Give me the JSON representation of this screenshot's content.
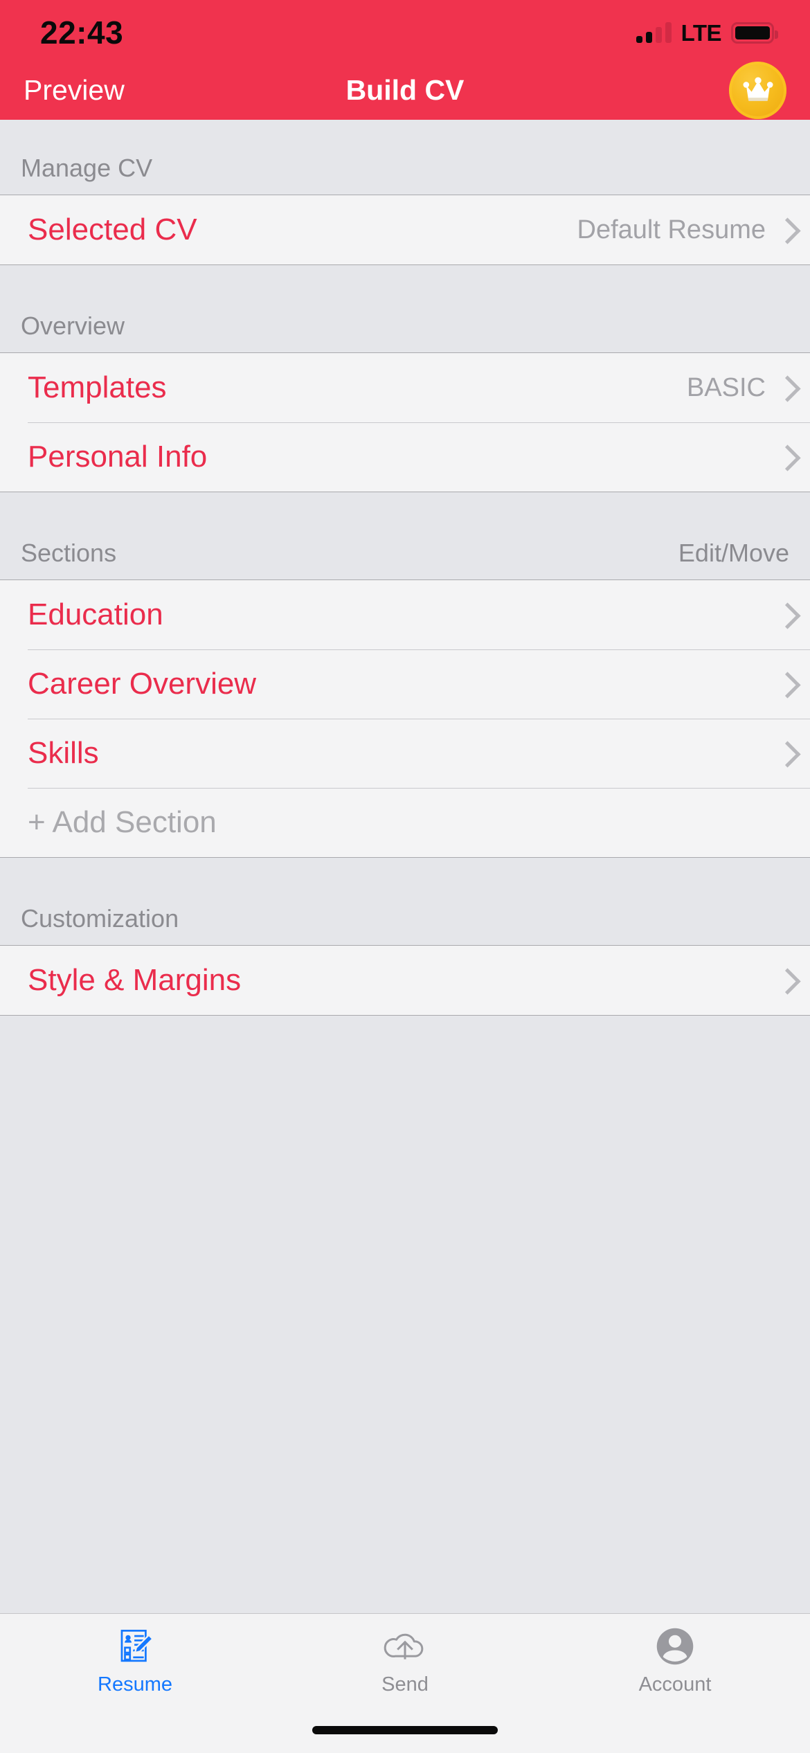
{
  "status_bar": {
    "time": "22:43",
    "network_label": "LTE",
    "signal_icon": "signal-bars-icon",
    "battery_icon": "battery-full-icon"
  },
  "nav_bar": {
    "left_button": "Preview",
    "title": "Build CV",
    "premium_badge_icon": "crown-icon",
    "background_color": "#f0334e"
  },
  "sections": [
    {
      "header": "Manage CV",
      "header_right": "",
      "rows": [
        {
          "label": "Selected CV",
          "value": "Default Resume",
          "accessory": "chevron-right-icon",
          "muted": false
        }
      ]
    },
    {
      "header": "Overview",
      "header_right": "",
      "rows": [
        {
          "label": "Templates",
          "value": "BASIC",
          "accessory": "chevron-right-icon",
          "muted": false
        },
        {
          "label": "Personal Info",
          "value": "",
          "accessory": "chevron-right-icon",
          "muted": false
        }
      ]
    },
    {
      "header": "Sections",
      "header_right": "Edit/Move",
      "rows": [
        {
          "label": "Education",
          "value": "",
          "accessory": "chevron-right-icon",
          "muted": false
        },
        {
          "label": "Career Overview",
          "value": "",
          "accessory": "chevron-right-icon",
          "muted": false
        },
        {
          "label": "Skills",
          "value": "",
          "accessory": "chevron-right-icon",
          "muted": false
        },
        {
          "label": "+ Add Section",
          "value": "",
          "accessory": "",
          "muted": true
        }
      ]
    },
    {
      "header": "Customization",
      "header_right": "",
      "rows": [
        {
          "label": "Style & Margins",
          "value": "",
          "accessory": "chevron-right-icon",
          "muted": false
        }
      ]
    }
  ],
  "tab_bar": {
    "tabs": [
      {
        "label": "Resume",
        "icon": "resume-document-pencil-icon",
        "active": true
      },
      {
        "label": "Send",
        "icon": "cloud-upload-icon",
        "active": false
      },
      {
        "label": "Account",
        "icon": "user-circle-icon",
        "active": false
      }
    ],
    "active_color": "#1478ff",
    "inactive_color": "#8e8e93"
  },
  "colors": {
    "accent_red": "#ea2c4c",
    "nav_red": "#f0334e",
    "row_background": "#f4f4f5",
    "header_background": "#e5e6ea"
  }
}
